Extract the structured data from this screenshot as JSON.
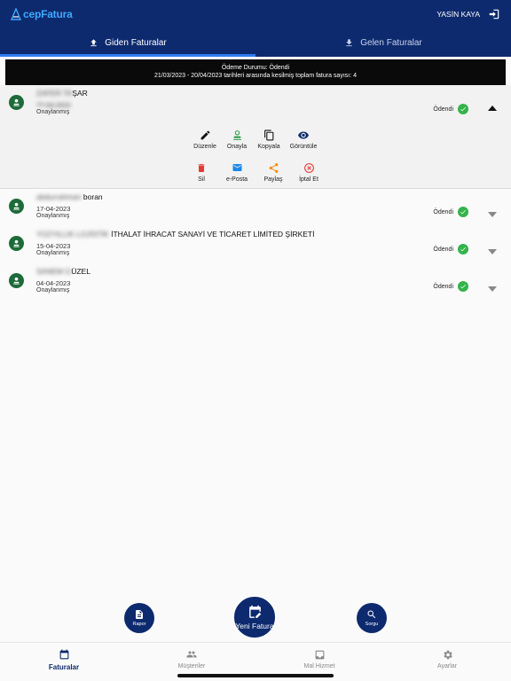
{
  "app": {
    "logo_prefix": "",
    "logo_text": "cepFatura",
    "user_name": "YASİN KAYA"
  },
  "tabs": [
    {
      "label": "Giden Faturalar",
      "active": true,
      "icon": "upload-icon"
    },
    {
      "label": "Gelen Faturalar",
      "active": false,
      "icon": "download-icon"
    }
  ],
  "banner": {
    "line1": "Ödeme Durumu: Ödendi",
    "line2": "21/03/2023 - 20/04/2023 tarihleri arasında kesilmiş toplam fatura sayısı: 4"
  },
  "invoices": [
    {
      "name_blurred": "ZAFER TA",
      "name_visible": "ŞAR",
      "date": "??-04-2023",
      "status": "Onaylanmış",
      "payment": "Ödendi",
      "expanded": true
    },
    {
      "name_blurred": "abdurrahman ",
      "name_visible": "boran",
      "date": "17-04-2023",
      "status": "Onaylanmış",
      "payment": "Ödendi",
      "expanded": false
    },
    {
      "name_blurred": "YÜZYILLIK LOJİSTİK ",
      "name_visible": "İTHALAT İHRACAT SANAYİ VE TİCARET LİMİTED ŞİRKETİ",
      "date": "15-04-2023",
      "status": "Onaylanmış",
      "payment": "Ödendi",
      "expanded": false
    },
    {
      "name_blurred": "SANEM G",
      "name_visible": "ÜZEL",
      "date": "04-04-2023",
      "status": "Onaylanmış",
      "payment": "Ödendi",
      "expanded": false
    }
  ],
  "actions": {
    "edit": "Düzenle",
    "approve": "Onayla",
    "copy": "Kopyala",
    "view": "Görüntüle",
    "delete": "Sil",
    "email": "e-Posta",
    "share": "Paylaş",
    "cancel": "İptal Et"
  },
  "fabs": {
    "report": "Rapor",
    "new_invoice": "Yeni Fatura",
    "query": "Sorgu"
  },
  "bottom_nav": [
    {
      "label": "Faturalar",
      "active": true
    },
    {
      "label": "Müşteriler",
      "active": false
    },
    {
      "label": "Mal Hizmet",
      "active": false
    },
    {
      "label": "Ayarlar",
      "active": false
    }
  ],
  "colors": {
    "navy": "#0d2a6e",
    "accent": "#2f7df1",
    "paid_green": "#34b34a",
    "approve_green": "#2e9e4a",
    "delete_red": "#e53935",
    "email_blue": "#1e88e5",
    "share_orange": "#fb8c00"
  }
}
